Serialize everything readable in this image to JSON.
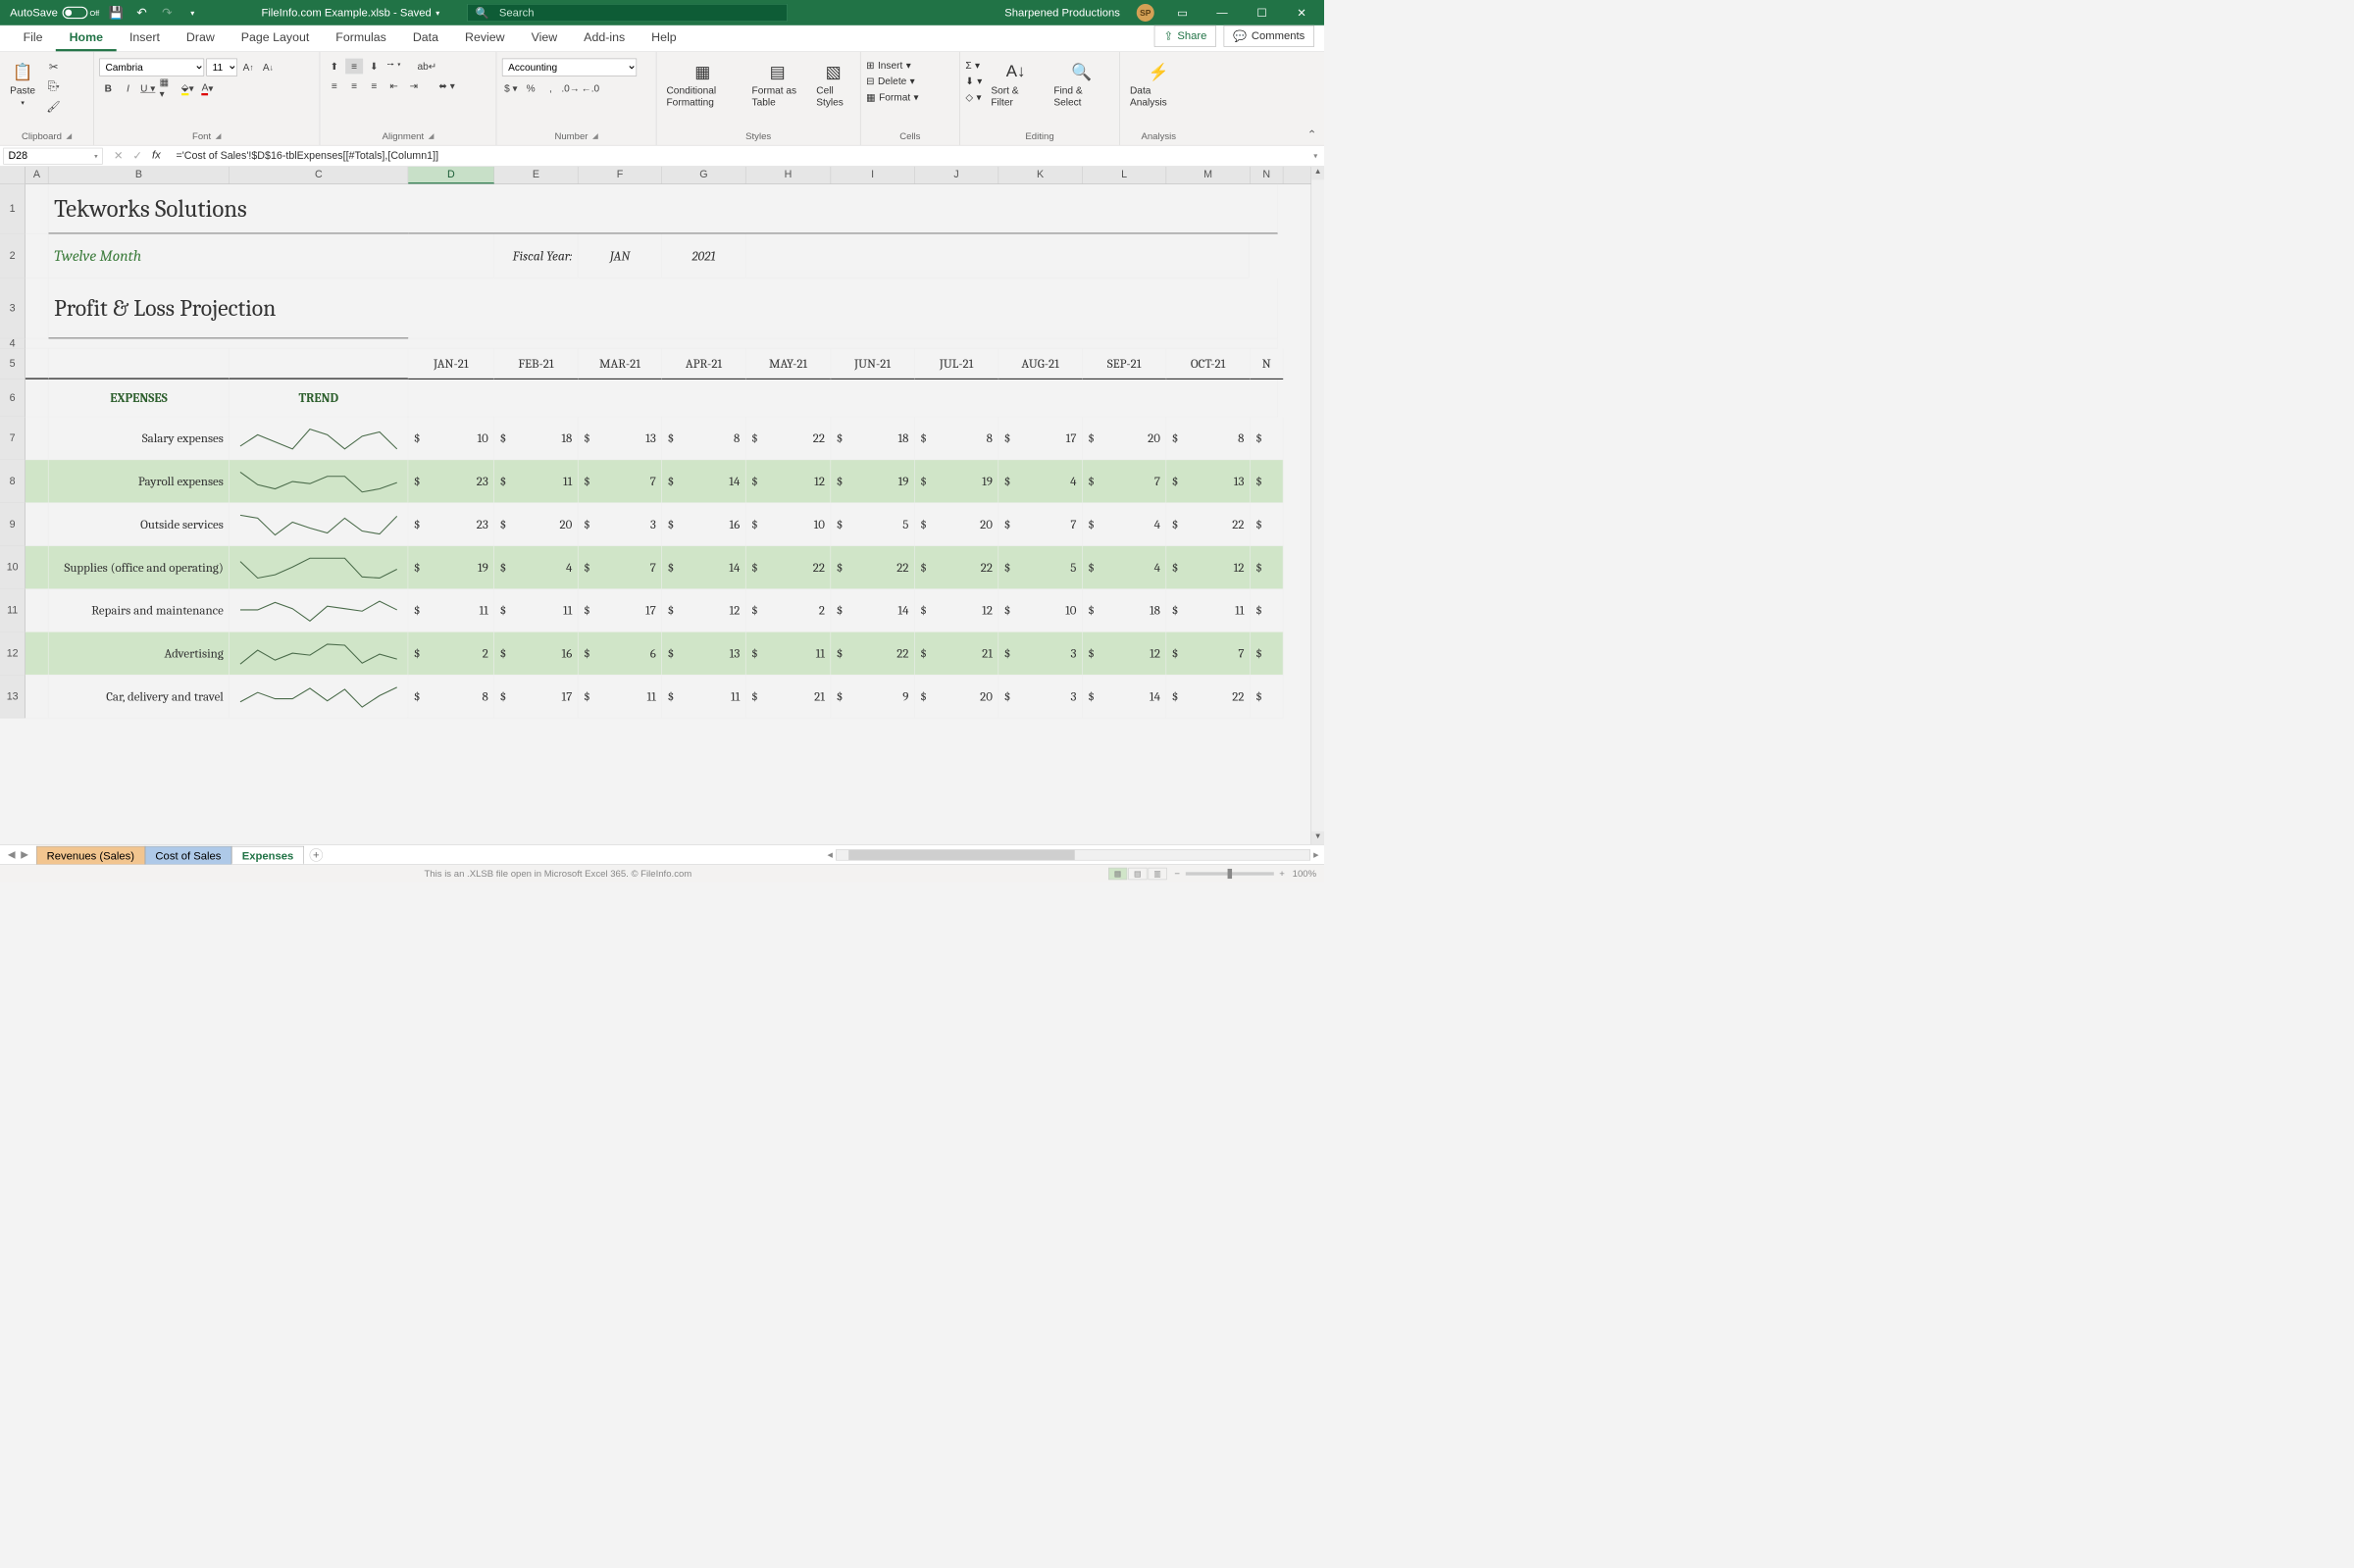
{
  "titlebar": {
    "autosave_label": "AutoSave",
    "autosave_state": "Off",
    "doc_name": "FileInfo.com Example.xlsb - Saved",
    "search_placeholder": "Search",
    "account_name": "Sharpened Productions",
    "account_initials": "SP"
  },
  "tabs": {
    "items": [
      "File",
      "Home",
      "Insert",
      "Draw",
      "Page Layout",
      "Formulas",
      "Data",
      "Review",
      "View",
      "Add-ins",
      "Help"
    ],
    "active": "Home",
    "share": "Share",
    "comments": "Comments"
  },
  "ribbon": {
    "clipboard": {
      "paste": "Paste",
      "label": "Clipboard"
    },
    "font": {
      "name": "Cambria",
      "size": "11",
      "label": "Font"
    },
    "alignment": {
      "label": "Alignment"
    },
    "number": {
      "format": "Accounting",
      "label": "Number"
    },
    "styles": {
      "cond": "Conditional Formatting",
      "table": "Format as Table",
      "cell": "Cell Styles",
      "label": "Styles"
    },
    "cells": {
      "insert": "Insert",
      "delete": "Delete",
      "format": "Format",
      "label": "Cells"
    },
    "editing": {
      "sortfilter": "Sort & Filter",
      "findselect": "Find & Select",
      "label": "Editing"
    },
    "analysis": {
      "data": "Data Analysis",
      "label": "Analysis"
    }
  },
  "formula_bar": {
    "cell_ref": "D28",
    "formula": "='Cost of Sales'!$D$16-tblExpenses[[#Totals],[Column1]]"
  },
  "columns": [
    "A",
    "B",
    "C",
    "D",
    "E",
    "F",
    "G",
    "H",
    "I",
    "J",
    "K",
    "L",
    "M",
    "N"
  ],
  "sheet": {
    "company": "Tekworks Solutions",
    "subtitle": "Twelve Month",
    "heading": "Profit & Loss Projection",
    "fy_label": "Fiscal Year:",
    "fy_month": "JAN",
    "fy_year": "2021",
    "months": [
      "JAN-21",
      "FEB-21",
      "MAR-21",
      "APR-21",
      "MAY-21",
      "JUN-21",
      "JUL-21",
      "AUG-21",
      "SEP-21",
      "OCT-21"
    ],
    "next_month_partial": "N",
    "section_expenses": "EXPENSES",
    "section_trend": "TREND",
    "rows": [
      {
        "name": "Salary expenses",
        "vals": [
          10,
          18,
          13,
          8,
          22,
          18,
          8,
          17,
          20,
          8
        ]
      },
      {
        "name": "Payroll expenses",
        "vals": [
          23,
          11,
          7,
          14,
          12,
          19,
          19,
          4,
          7,
          13
        ]
      },
      {
        "name": "Outside services",
        "vals": [
          23,
          20,
          3,
          16,
          10,
          5,
          20,
          7,
          4,
          22
        ]
      },
      {
        "name": "Supplies (office and operating)",
        "vals": [
          19,
          4,
          7,
          14,
          22,
          22,
          22,
          5,
          4,
          12
        ]
      },
      {
        "name": "Repairs and maintenance",
        "vals": [
          11,
          11,
          17,
          12,
          2,
          14,
          12,
          10,
          18,
          11
        ]
      },
      {
        "name": "Advertising",
        "vals": [
          2,
          16,
          6,
          13,
          11,
          22,
          21,
          3,
          12,
          7
        ]
      },
      {
        "name": "Car, delivery and travel",
        "vals": [
          8,
          17,
          11,
          11,
          21,
          9,
          20,
          3,
          14,
          22
        ]
      }
    ]
  },
  "sheet_tabs": {
    "tabs": [
      "Revenues (Sales)",
      "Cost of Sales",
      "Expenses"
    ],
    "active": "Expenses"
  },
  "statusbar": {
    "info": "This is an .XLSB file open in Microsoft Excel 365. © FileInfo.com",
    "zoom": "100%"
  }
}
